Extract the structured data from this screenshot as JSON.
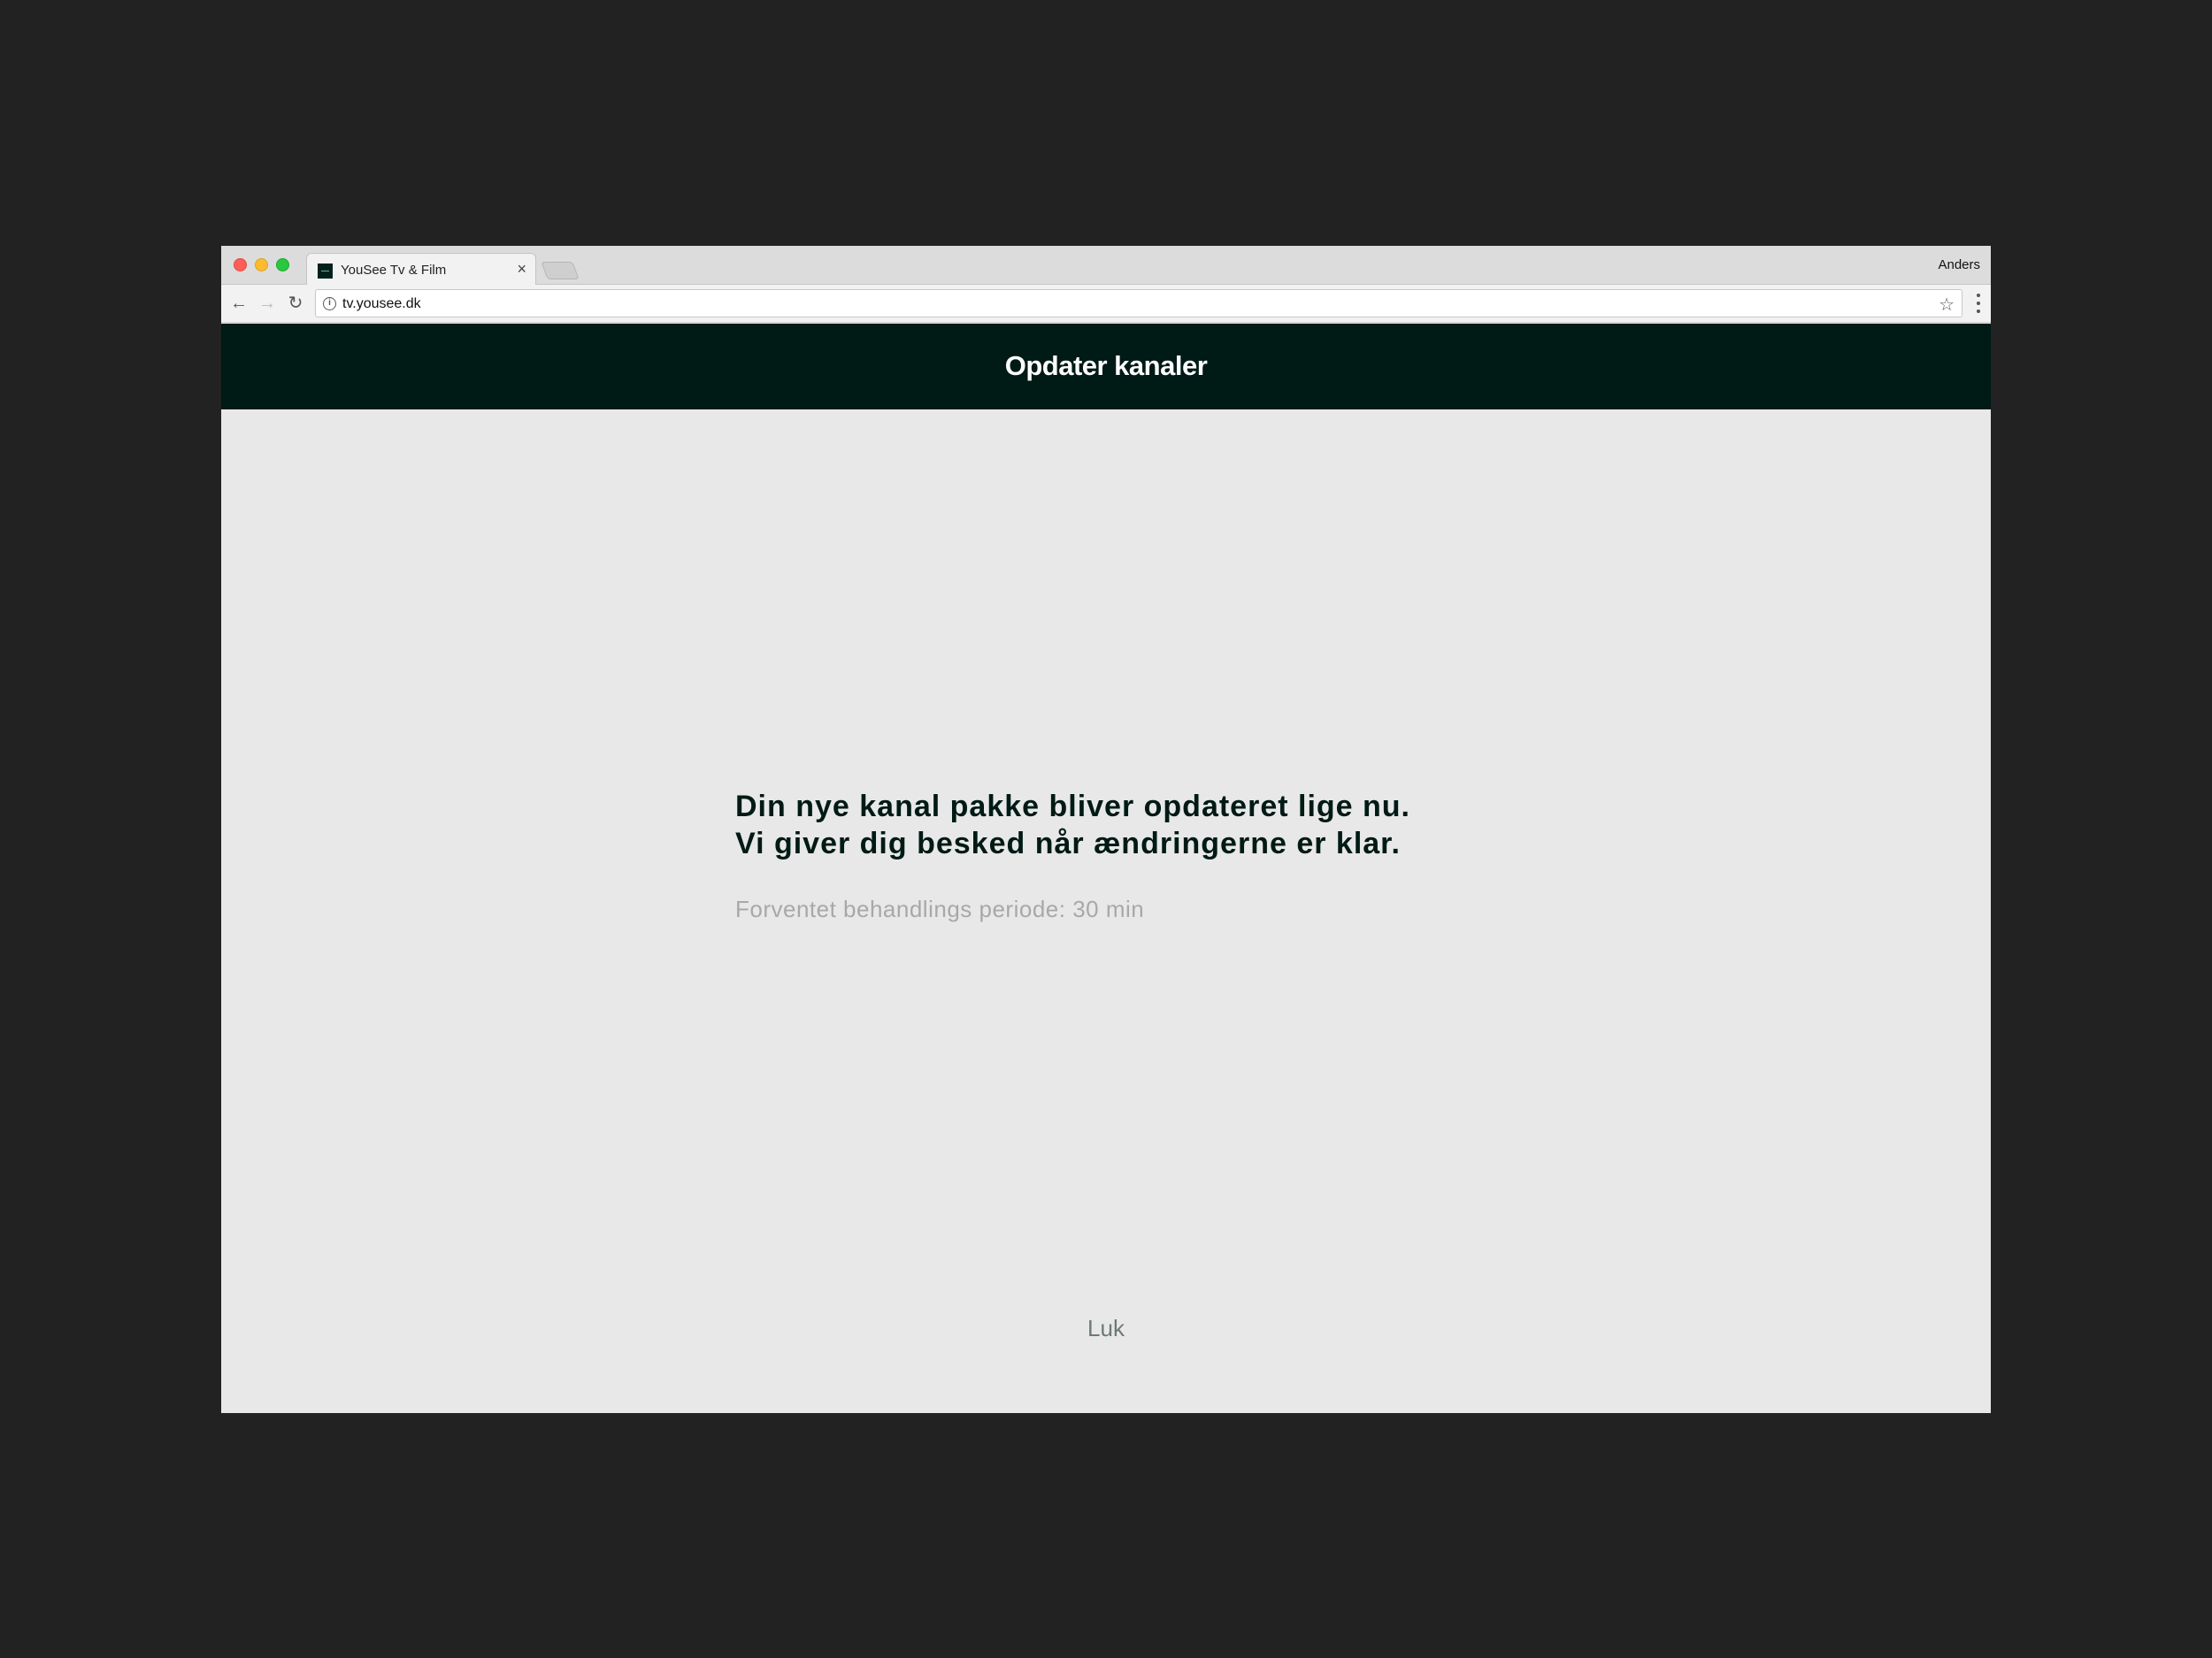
{
  "browser": {
    "tab_title": "YouSee Tv & Film",
    "tab_close": "×",
    "profile_name": "Anders",
    "url": "tv.yousee.dk",
    "back_glyph": "←",
    "forward_glyph": "→",
    "reload_glyph": "↻",
    "info_glyph": "i",
    "star_glyph": "☆"
  },
  "header": {
    "title": "Opdater kanaler",
    "background": "#001a15"
  },
  "main": {
    "message_line1": "Din nye kanal pakke bliver opdateret lige nu.",
    "message_line2": "Vi giver dig besked når ændringerne er klar.",
    "subtext": "Forventet behandlings periode: 30 min",
    "close_label": "Luk"
  }
}
